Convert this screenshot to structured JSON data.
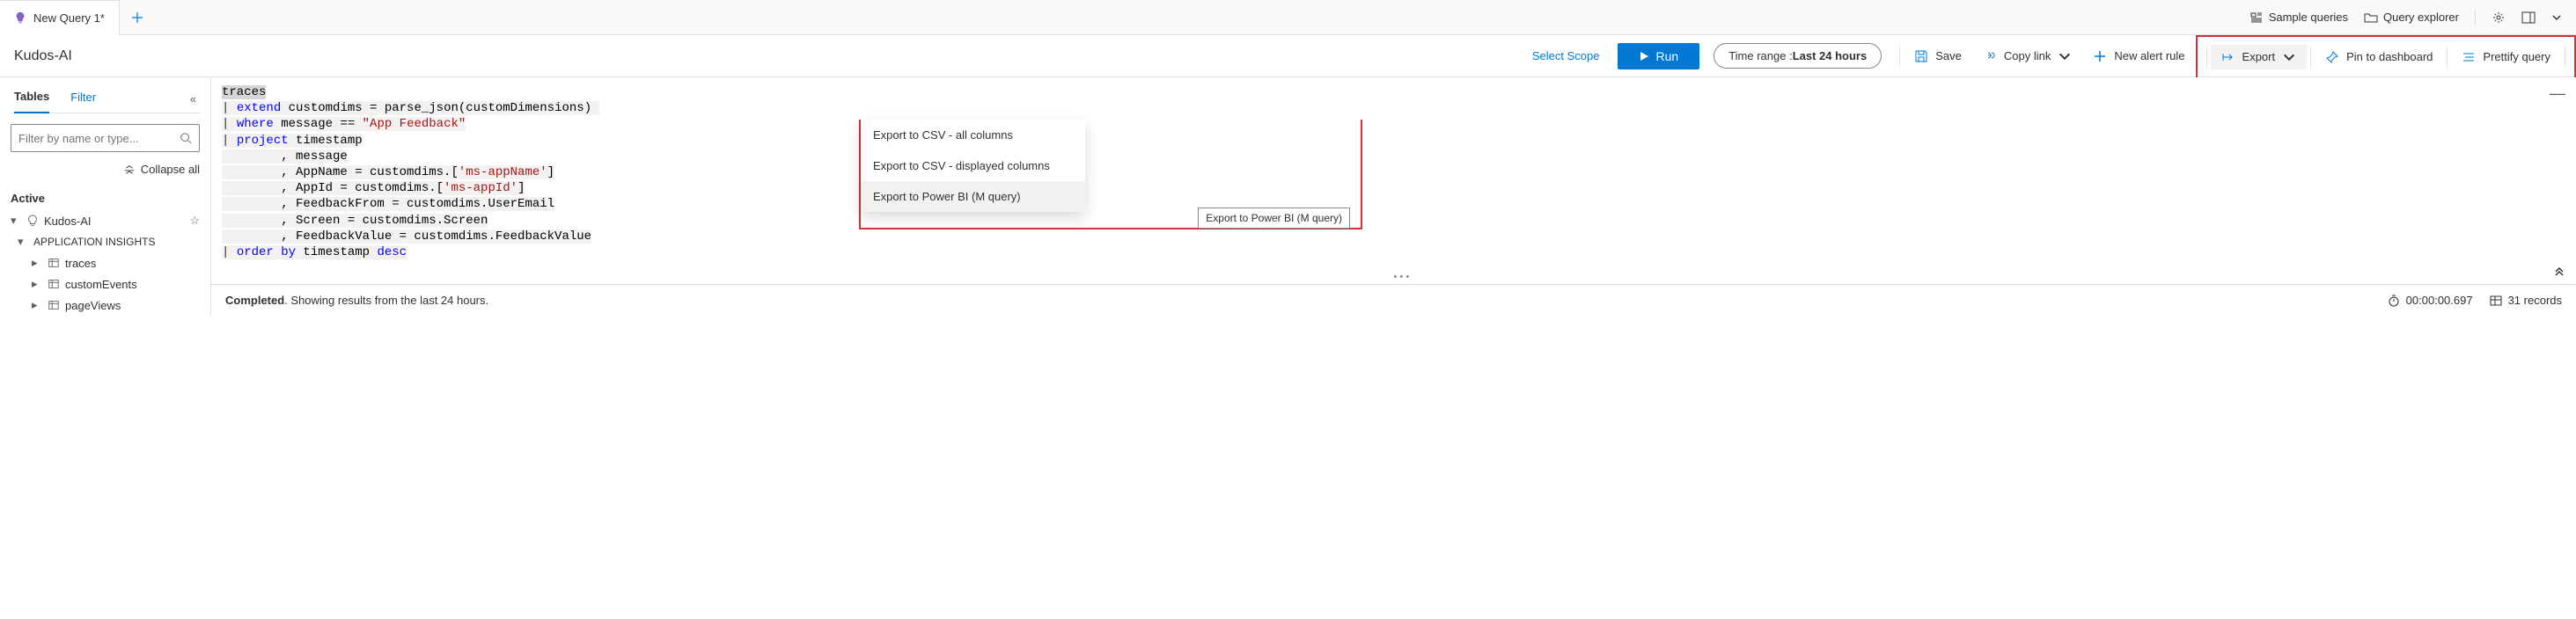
{
  "tab": {
    "title": "New Query 1*"
  },
  "top_right": {
    "sample_queries": "Sample queries",
    "query_explorer": "Query explorer"
  },
  "toolbar": {
    "workspace": "Kudos-AI",
    "select_scope": "Select Scope",
    "run": "Run",
    "time_range_prefix": "Time range : ",
    "time_range_value": "Last 24 hours",
    "save": "Save",
    "copy_link": "Copy link",
    "new_alert_rule": "New alert rule",
    "export": "Export",
    "pin_dashboard": "Pin to dashboard",
    "prettify": "Prettify query"
  },
  "sidebar": {
    "tabs": {
      "tables": "Tables",
      "filter": "Filter"
    },
    "search_placeholder": "Filter by name or type...",
    "collapse_all": "Collapse all",
    "active": "Active",
    "root": "Kudos-AI",
    "group": "APPLICATION INSIGHTS",
    "tables_list": [
      "traces",
      "customEvents",
      "pageViews"
    ]
  },
  "code": {
    "line1": "traces",
    "line2_kw": "extend",
    "line2_rest": " customdims = parse_json(customDimensions)",
    "line3_kw": "where",
    "line3_mid": " message == ",
    "line3_str": "\"App Feedback\"",
    "line4_kw": "project",
    "line4_rest": " timestamp",
    "line5": "        , message",
    "line6a": "        , AppName = customdims.[",
    "line6s": "'ms-appName'",
    "line6b": "]",
    "line7a": "        , AppId = customdims.[",
    "line7s": "'ms-appId'",
    "line7b": "]",
    "line8": "        , FeedbackFrom = customdims.UserEmail",
    "line9": "        , Screen = customdims.Screen",
    "line10": "        , FeedbackValue = customdims.FeedbackValue",
    "line11_kw": "order by",
    "line11_rest": " timestamp ",
    "line11_kw2": "desc"
  },
  "export_menu": {
    "items": [
      "Export to CSV - all columns",
      "Export to CSV - displayed columns",
      "Export to Power BI (M query)"
    ],
    "tooltip": "Export to Power BI (M query)"
  },
  "status": {
    "completed": "Completed",
    "message": ". Showing results from the last 24 hours.",
    "duration": "00:00:00.697",
    "records": "31 records"
  }
}
